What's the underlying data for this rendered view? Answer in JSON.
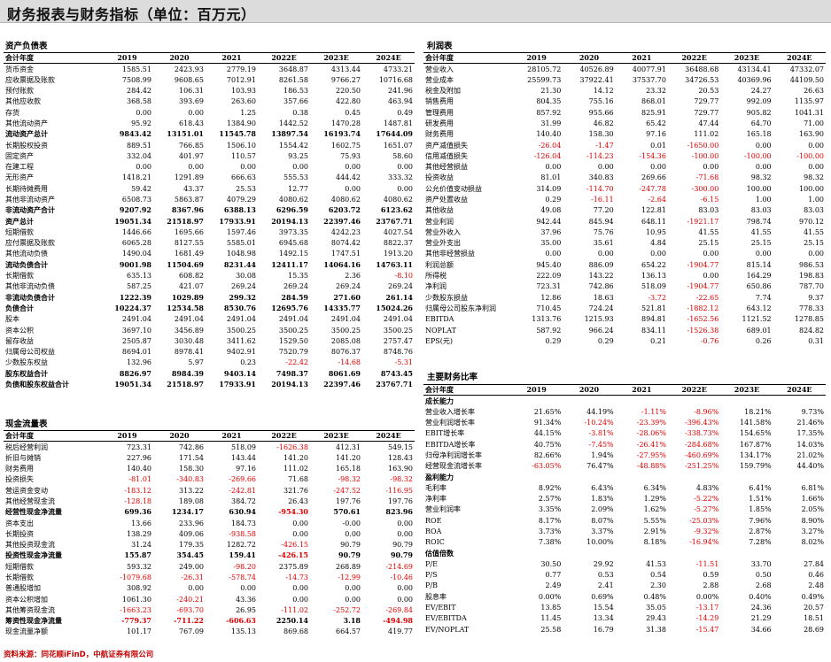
{
  "header": {
    "title": "财务报表与财务指标（单位：百万元）"
  },
  "balance": {
    "title": "资产负债表",
    "columns": [
      "会计年度",
      "2019",
      "2020",
      "2021",
      "2022E",
      "2023E",
      "2024E"
    ],
    "rows": [
      [
        "货币资金",
        "1585.51",
        "2423.93",
        "2779.19",
        "3648.87",
        "4313.44",
        "4733.21"
      ],
      [
        "应收票据及账款",
        "7508.99",
        "9608.65",
        "7012.91",
        "8261.58",
        "9766.27",
        "10716.68"
      ],
      [
        "预付账款",
        "284.42",
        "106.31",
        "103.93",
        "186.53",
        "220.50",
        "241.96"
      ],
      [
        "其他应收款",
        "368.58",
        "393.69",
        "263.60",
        "357.66",
        "422.80",
        "463.94"
      ],
      [
        "存货",
        "0.00",
        "0.00",
        "1.25",
        "0.38",
        "0.45",
        "0.49"
      ],
      [
        "其他流动资产",
        "95.92",
        "618.43",
        "1384.90",
        "1442.52",
        "1470.28",
        "1487.81"
      ],
      [
        "流动资产总计",
        "9843.42",
        "13151.01",
        "11545.78",
        "13897.54",
        "16193.74",
        "17644.09"
      ],
      [
        "长期股权投资",
        "889.51",
        "766.85",
        "1506.10",
        "1554.42",
        "1602.75",
        "1651.07"
      ],
      [
        "固定资产",
        "332.04",
        "401.97",
        "110.57",
        "93.25",
        "75.93",
        "58.60"
      ],
      [
        "在建工程",
        "0.00",
        "0.00",
        "0.00",
        "0.00",
        "0.00",
        "0.00"
      ],
      [
        "无形资产",
        "1418.21",
        "1291.89",
        "666.63",
        "555.53",
        "444.42",
        "333.32"
      ],
      [
        "长期待摊费用",
        "59.42",
        "43.37",
        "25.53",
        "12.77",
        "0.00",
        "0.00"
      ],
      [
        "其他非流动资产",
        "6508.73",
        "5863.87",
        "4079.29",
        "4080.62",
        "4080.62",
        "4080.62"
      ],
      [
        "非流动资产合计",
        "9207.92",
        "8367.96",
        "6388.13",
        "6296.59",
        "6203.72",
        "6123.62"
      ],
      [
        "资产总计",
        "19051.34",
        "21518.97",
        "17933.91",
        "20194.13",
        "22397.46",
        "23767.71"
      ],
      [
        "短期借款",
        "1446.66",
        "1695.66",
        "1597.46",
        "3973.35",
        "4242.23",
        "4027.54"
      ],
      [
        "应付票据及账款",
        "6065.28",
        "8127.55",
        "5585.01",
        "6945.68",
        "8074.42",
        "8822.37"
      ],
      [
        "其他流动负债",
        "1490.04",
        "1681.49",
        "1048.98",
        "1492.15",
        "1747.51",
        "1913.20"
      ],
      [
        "流动负债合计",
        "9001.98",
        "11504.69",
        "8231.44",
        "12411.17",
        "14064.16",
        "14763.11"
      ],
      [
        "长期借款",
        "635.13",
        "608.82",
        "30.08",
        "15.35",
        "2.36",
        "-8.10"
      ],
      [
        "其他非流动负债",
        "587.25",
        "421.07",
        "269.24",
        "269.24",
        "269.24",
        "269.24"
      ],
      [
        "非流动负债合计",
        "1222.39",
        "1029.89",
        "299.32",
        "284.59",
        "271.60",
        "261.14"
      ],
      [
        "负债合计",
        "10224.37",
        "12534.58",
        "8530.76",
        "12695.76",
        "14335.77",
        "15024.26"
      ],
      [
        "股本",
        "2491.04",
        "2491.04",
        "2491.04",
        "2491.04",
        "2491.04",
        "2491.04"
      ],
      [
        "资本公积",
        "3697.10",
        "3456.89",
        "3500.25",
        "3500.25",
        "3500.25",
        "3500.25"
      ],
      [
        "留存收益",
        "2505.87",
        "3030.48",
        "3411.62",
        "1529.50",
        "2085.08",
        "2757.47"
      ],
      [
        "归属母公司权益",
        "8694.01",
        "8978.41",
        "9402.91",
        "7520.79",
        "8076.37",
        "8748.76"
      ],
      [
        "少数股东权益",
        "132.96",
        "5.97",
        "0.23",
        "-22.42",
        "-14.68",
        "-5.31"
      ],
      [
        "股东权益合计",
        "8826.97",
        "8984.39",
        "9403.14",
        "7498.37",
        "8061.69",
        "8743.45"
      ],
      [
        "负债和股东权益合计",
        "19051.34",
        "21518.97",
        "17933.91",
        "20194.13",
        "22397.46",
        "23767.71"
      ]
    ]
  },
  "income": {
    "title": "利润表",
    "columns": [
      "会计年度",
      "2019",
      "2020",
      "2021",
      "2022E",
      "2023E",
      "2024E"
    ],
    "rows": [
      [
        "营业收入",
        "28105.72",
        "40526.89",
        "40077.91",
        "36488.68",
        "43134.41",
        "47332.07"
      ],
      [
        "营业成本",
        "25599.73",
        "37922.41",
        "37537.70",
        "34726.53",
        "40369.96",
        "44109.50"
      ],
      [
        "税金及附加",
        "21.30",
        "14.12",
        "23.32",
        "20.53",
        "24.27",
        "26.63"
      ],
      [
        "销售费用",
        "804.35",
        "755.16",
        "868.01",
        "729.77",
        "992.09",
        "1135.97"
      ],
      [
        "管理费用",
        "857.92",
        "955.66",
        "825.91",
        "729.77",
        "905.82",
        "1041.31"
      ],
      [
        "研发费用",
        "31.99",
        "46.82",
        "65.42",
        "47.44",
        "64.70",
        "71.00"
      ],
      [
        "财务费用",
        "140.40",
        "158.30",
        "97.16",
        "111.02",
        "165.18",
        "163.90"
      ],
      [
        "资产减值损失",
        "-26.04",
        "-1.47",
        "0.01",
        "-1650.00",
        "0.00",
        "0.00"
      ],
      [
        "信用减值损失",
        "-126.04",
        "-114.23",
        "-154.36",
        "-100.00",
        "-100.00",
        "-100.00"
      ],
      [
        "其他经营损益",
        "0.00",
        "0.00",
        "0.00",
        "0.00",
        "0.00",
        "0.00"
      ],
      [
        "投资收益",
        "81.01",
        "340.83",
        "269.66",
        "-71.68",
        "98.32",
        "98.32"
      ],
      [
        "公允价值变动损益",
        "314.09",
        "-114.70",
        "-247.78",
        "-300.00",
        "100.00",
        "100.00"
      ],
      [
        "资产处置收益",
        "0.29",
        "-16.11",
        "-2.64",
        "-6.15",
        "1.00",
        "1.00"
      ],
      [
        "其他收益",
        "49.08",
        "77.20",
        "122.81",
        "83.03",
        "83.03",
        "83.03"
      ],
      [
        "营业利润",
        "942.44",
        "845.94",
        "648.11",
        "-1921.17",
        "798.74",
        "970.12"
      ],
      [
        "营业外收入",
        "37.96",
        "75.76",
        "10.95",
        "41.55",
        "41.55",
        "41.55"
      ],
      [
        "营业外支出",
        "35.00",
        "35.61",
        "4.84",
        "25.15",
        "25.15",
        "25.15"
      ],
      [
        "其他非经营损益",
        "0.00",
        "0.00",
        "0.00",
        "0.00",
        "0.00",
        "0.00"
      ],
      [
        "利润总额",
        "945.40",
        "886.09",
        "654.22",
        "-1904.77",
        "815.14",
        "986.53"
      ],
      [
        "所得税",
        "222.09",
        "143.22",
        "136.13",
        "0.00",
        "164.29",
        "198.83"
      ],
      [
        "净利润",
        "723.31",
        "742.86",
        "518.09",
        "-1904.77",
        "650.86",
        "787.70"
      ],
      [
        "少数股东损益",
        "12.86",
        "18.63",
        "-3.72",
        "-22.65",
        "7.74",
        "9.37"
      ],
      [
        "归属母公司股东净利润",
        "710.45",
        "724.24",
        "521.81",
        "-1882.12",
        "643.12",
        "778.33"
      ],
      [
        "EBITDA",
        "1313.76",
        "1215.93",
        "894.81",
        "-1652.56",
        "1121.52",
        "1278.85"
      ],
      [
        "NOPLAT",
        "587.92",
        "966.24",
        "834.11",
        "-1526.38",
        "689.01",
        "824.82"
      ],
      [
        "EPS(元)",
        "0.29",
        "0.29",
        "0.21",
        "-0.76",
        "0.26",
        "0.31"
      ]
    ]
  },
  "cashflow": {
    "title": "现金流量表",
    "columns": [
      "会计年度",
      "2019",
      "2020",
      "2021",
      "2022E",
      "2023E",
      "2024E"
    ],
    "rows": [
      [
        "税后经营利润",
        "723.31",
        "742.86",
        "518.09",
        "-1626.38",
        "412.31",
        "549.15"
      ],
      [
        "折旧与摊销",
        "227.96",
        "171.54",
        "143.44",
        "141.20",
        "141.20",
        "128.43"
      ],
      [
        "财务费用",
        "140.40",
        "158.30",
        "97.16",
        "111.02",
        "165.18",
        "163.90"
      ],
      [
        "投资损失",
        "-81.01",
        "-340.83",
        "-269.66",
        "71.68",
        "-98.32",
        "-98.32"
      ],
      [
        "营运资金变动",
        "-183.12",
        "313.22",
        "-242.81",
        "321.76",
        "-247.52",
        "-116.95"
      ],
      [
        "其他经营现金流",
        "-128.18",
        "189.08",
        "384.72",
        "26.43",
        "197.76",
        "197.76"
      ],
      [
        "经营性现金净流量",
        "699.36",
        "1234.17",
        "630.94",
        "-954.30",
        "570.61",
        "823.96"
      ],
      [
        "资本支出",
        "13.66",
        "233.96",
        "184.73",
        "0.00",
        "-0.00",
        "0.00"
      ],
      [
        "长期投资",
        "138.29",
        "409.06",
        "-938.58",
        "0.00",
        "0.00",
        "0.00"
      ],
      [
        "其他投资现金流",
        "31.24",
        "179.35",
        "1282.72",
        "-426.15",
        "90.79",
        "90.79"
      ],
      [
        "投资性现金净流量",
        "155.87",
        "354.45",
        "159.41",
        "-426.15",
        "90.79",
        "90.79"
      ],
      [
        "短期借款",
        "593.32",
        "249.00",
        "-98.20",
        "2375.89",
        "268.89",
        "-214.69"
      ],
      [
        "长期借款",
        "-1079.68",
        "-26.31",
        "-578.74",
        "-14.73",
        "-12.99",
        "-10.46"
      ],
      [
        "普通股增加",
        "308.92",
        "0.00",
        "0.00",
        "0.00",
        "0.00",
        "0.00"
      ],
      [
        "资本公积增加",
        "1061.30",
        "-240.21",
        "43.36",
        "0.00",
        "0.00",
        "0.00"
      ],
      [
        "其他筹资现金流",
        "-1663.23",
        "-693.70",
        "26.95",
        "-111.02",
        "-252.72",
        "-269.84"
      ],
      [
        "筹资性现金净流量",
        "-779.37",
        "-711.22",
        "-606.63",
        "2250.14",
        "3.18",
        "-494.98"
      ],
      [
        "现金流量净额",
        "101.17",
        "767.09",
        "135.13",
        "869.68",
        "664.57",
        "419.77"
      ]
    ]
  },
  "ratios": {
    "title": "主要财务比率",
    "columns": [
      "会计年度",
      "2019",
      "2020",
      "2021",
      "2022E",
      "2023E",
      "2024E"
    ],
    "rows": [
      [
        "成长能力",
        "",
        "",
        "",
        "",
        "",
        ""
      ],
      [
        "营业收入增长率",
        "21.65%",
        "44.19%",
        "-1.11%",
        "-8.96%",
        "18.21%",
        "9.73%"
      ],
      [
        "营业利润增长率",
        "91.34%",
        "-10.24%",
        "-23.39%",
        "-396.43%",
        "141.58%",
        "21.46%"
      ],
      [
        "EBIT增长率",
        "44.15%",
        "-3.81%",
        "-28.06%",
        "-338.73%",
        "154.65%",
        "17.35%"
      ],
      [
        "EBITDA增长率",
        "40.75%",
        "-7.45%",
        "-26.41%",
        "-284.68%",
        "167.87%",
        "14.03%"
      ],
      [
        "归母净利润增长率",
        "82.66%",
        "1.94%",
        "-27.95%",
        "-460.69%",
        "134.17%",
        "21.02%"
      ],
      [
        "经营现金流增长率",
        "-63.05%",
        "76.47%",
        "-48.88%",
        "-251.25%",
        "159.79%",
        "44.40%"
      ],
      [
        "盈利能力",
        "",
        "",
        "",
        "",
        "",
        ""
      ],
      [
        "毛利率",
        "8.92%",
        "6.43%",
        "6.34%",
        "4.83%",
        "6.41%",
        "6.81%"
      ],
      [
        "净利率",
        "2.57%",
        "1.83%",
        "1.29%",
        "-5.22%",
        "1.51%",
        "1.66%"
      ],
      [
        "营业利润率",
        "3.35%",
        "2.09%",
        "1.62%",
        "-5.27%",
        "1.85%",
        "2.05%"
      ],
      [
        "ROE",
        "8.17%",
        "8.07%",
        "5.55%",
        "-25.03%",
        "7.96%",
        "8.90%"
      ],
      [
        "ROA",
        "3.73%",
        "3.37%",
        "2.91%",
        "-9.32%",
        "2.87%",
        "3.27%"
      ],
      [
        "ROIC",
        "7.38%",
        "10.00%",
        "8.18%",
        "-16.94%",
        "7.28%",
        "8.02%"
      ],
      [
        "估值倍数",
        "",
        "",
        "",
        "",
        "",
        ""
      ],
      [
        "P/E",
        "30.50",
        "29.92",
        "41.53",
        "-11.51",
        "33.70",
        "27.84"
      ],
      [
        "P/S",
        "0.77",
        "0.53",
        "0.54",
        "0.59",
        "0.50",
        "0.46"
      ],
      [
        "P/B",
        "2.49",
        "2.41",
        "2.30",
        "2.88",
        "2.68",
        "2.48"
      ],
      [
        "股息率",
        "0.00%",
        "0.69%",
        "0.48%",
        "0.00%",
        "0.40%",
        "0.49%"
      ],
      [
        "EV/EBIT",
        "13.85",
        "15.54",
        "35.05",
        "-13.17",
        "24.36",
        "20.57"
      ],
      [
        "EV/EBITDA",
        "11.45",
        "13.34",
        "29.43",
        "-14.29",
        "21.29",
        "18.51"
      ],
      [
        "EV/NOPLAT",
        "25.58",
        "16.79",
        "31.38",
        "-15.47",
        "34.66",
        "28.69"
      ]
    ]
  },
  "footer": {
    "source": "资料来源：同花顺iFinD，中航证券有限公司"
  },
  "colors": {
    "negative": "#e00000",
    "title_bg": "#dcdcdc",
    "footer": "#c00000"
  }
}
